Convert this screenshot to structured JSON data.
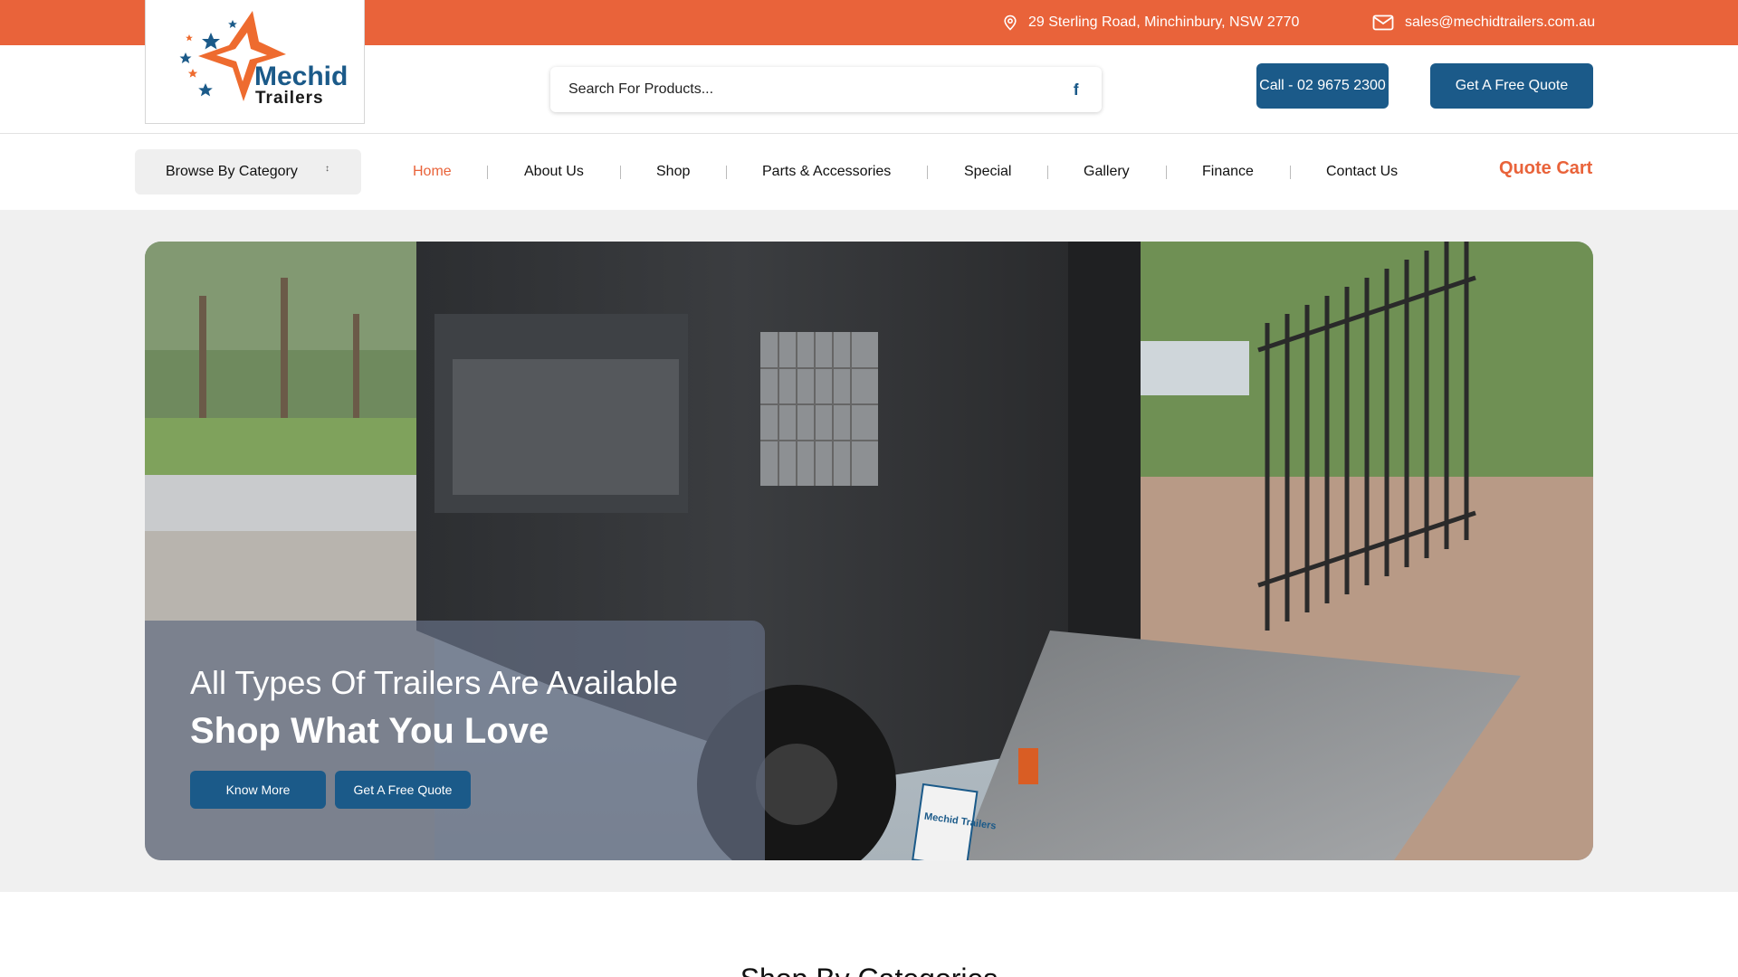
{
  "topbar": {
    "address": "29 Sterling Road, Minchinbury, NSW 2770",
    "email": "sales@mechidtrailers.com.au",
    "background": "#e9633a"
  },
  "logo": {
    "line1": "Mechid",
    "line2": "Trailers"
  },
  "search": {
    "placeholder": "Search For Products...",
    "icon": "search-icon"
  },
  "header": {
    "call_label": "Call - 02 9675 2300",
    "quote_label": "Get A Free Quote",
    "button_color": "#1b5a89"
  },
  "nav": {
    "browse_label": "Browse By Category",
    "items": [
      {
        "label": "Home",
        "active": true
      },
      {
        "label": "About Us"
      },
      {
        "label": "Shop"
      },
      {
        "label": "Parts & Accessories"
      },
      {
        "label": "Special"
      },
      {
        "label": "Gallery"
      },
      {
        "label": "Finance"
      },
      {
        "label": "Contact Us"
      }
    ],
    "quote_cart": "Quote Cart",
    "accent": "#e9633a"
  },
  "hero": {
    "line1": "All Types Of Trailers Are Available",
    "line2": "Shop What You Love",
    "know_more": "Know More",
    "free_quote": "Get A Free Quote",
    "plate_text": "Mechid Trailers"
  },
  "section": {
    "title": "Shop By Categories"
  }
}
